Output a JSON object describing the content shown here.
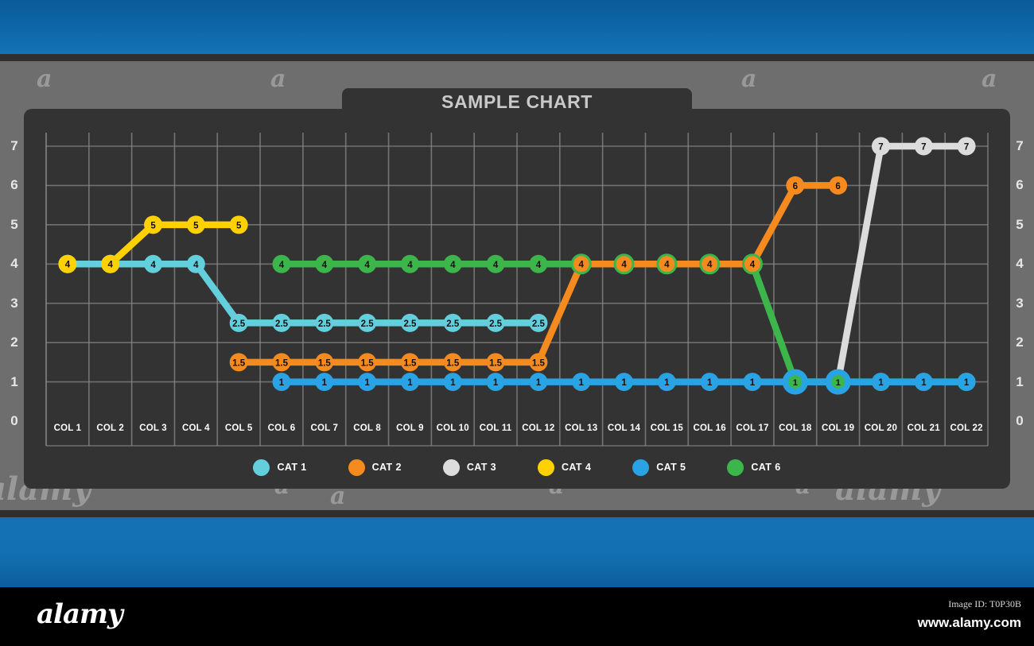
{
  "footer": {
    "logo": "alamy",
    "image_id": "Image ID: T0P30B",
    "url": "www.alamy.com"
  },
  "watermark": {
    "text": "a",
    "word": "alamy"
  },
  "chart": {
    "title": "SAMPLE CHART",
    "y_axis_labels_left": [
      "7",
      "6",
      "5",
      "4",
      "3",
      "2",
      "1",
      "0"
    ],
    "y_axis_labels_right": [
      "7",
      "6",
      "5",
      "4",
      "3",
      "2",
      "1",
      "0"
    ]
  },
  "chart_data": {
    "type": "line",
    "title": "SAMPLE CHART",
    "xlabel": "",
    "ylabel": "",
    "ylim": [
      0,
      7.6
    ],
    "grid": true,
    "legend_position": "bottom",
    "categories": [
      "COL 1",
      "COL 2",
      "COL 3",
      "COL 4",
      "COL 5",
      "COL 6",
      "COL 7",
      "COL 8",
      "COL 9",
      "COL 10",
      "COL 11",
      "COL 12",
      "COL 13",
      "COL 14",
      "COL 15",
      "COL 16",
      "COL 17",
      "COL 18",
      "COL 19",
      "COL 20",
      "COL 21",
      "COL 22"
    ],
    "yticks": [
      0,
      1,
      2,
      3,
      4,
      5,
      6,
      7
    ],
    "series": [
      {
        "name": "CAT 1",
        "color": "#63cfdd",
        "points": [
          {
            "x": "COL 1",
            "y": 4,
            "label": "4"
          },
          {
            "x": "COL 2",
            "y": 4,
            "label": "4"
          },
          {
            "x": "COL 3",
            "y": 4,
            "label": "4"
          },
          {
            "x": "COL 4",
            "y": 4,
            "label": "4"
          },
          {
            "x": "COL 5",
            "y": 2.5,
            "label": "2.5"
          },
          {
            "x": "COL 6",
            "y": 2.5,
            "label": "2.5"
          },
          {
            "x": "COL 7",
            "y": 2.5,
            "label": "2.5"
          },
          {
            "x": "COL 8",
            "y": 2.5,
            "label": "2.5"
          },
          {
            "x": "COL 9",
            "y": 2.5,
            "label": "2.5"
          },
          {
            "x": "COL 10",
            "y": 2.5,
            "label": "2.5"
          },
          {
            "x": "COL 11",
            "y": 2.5,
            "label": "2.5"
          },
          {
            "x": "COL 12",
            "y": 2.5,
            "label": "2.5"
          }
        ]
      },
      {
        "name": "CAT 2",
        "color": "#f58a1f",
        "points": [
          {
            "x": "COL 5",
            "y": 1.5,
            "label": "1.5"
          },
          {
            "x": "COL 6",
            "y": 1.5,
            "label": "1.5"
          },
          {
            "x": "COL 7",
            "y": 1.5,
            "label": "1.5"
          },
          {
            "x": "COL 8",
            "y": 1.5,
            "label": "1.5"
          },
          {
            "x": "COL 9",
            "y": 1.5,
            "label": "1.5"
          },
          {
            "x": "COL 10",
            "y": 1.5,
            "label": "1.5"
          },
          {
            "x": "COL 11",
            "y": 1.5,
            "label": "1.5"
          },
          {
            "x": "COL 12",
            "y": 1.5,
            "label": "1.5"
          },
          {
            "x": "COL 13",
            "y": 4,
            "label": "4"
          },
          {
            "x": "COL 14",
            "y": 4,
            "label": "4"
          },
          {
            "x": "COL 15",
            "y": 4,
            "label": "4"
          },
          {
            "x": "COL 16",
            "y": 4,
            "label": "4"
          },
          {
            "x": "COL 17",
            "y": 4,
            "label": "4"
          },
          {
            "x": "COL 18",
            "y": 6,
            "label": "6"
          },
          {
            "x": "COL 19",
            "y": 6,
            "label": "6"
          }
        ]
      },
      {
        "name": "CAT 3",
        "color": "#dcdcdc",
        "points": [
          {
            "x": "COL 18",
            "y": 1,
            "label": ""
          },
          {
            "x": "COL 19",
            "y": 1,
            "label": ""
          },
          {
            "x": "COL 20",
            "y": 7,
            "label": "7"
          },
          {
            "x": "COL 21",
            "y": 7,
            "label": "7"
          },
          {
            "x": "COL 22",
            "y": 7,
            "label": "7"
          }
        ]
      },
      {
        "name": "CAT 4",
        "color": "#ffd100",
        "points": [
          {
            "x": "COL 1",
            "y": 4,
            "label": "4"
          },
          {
            "x": "COL 2",
            "y": 4,
            "label": "4"
          },
          {
            "x": "COL 3",
            "y": 5,
            "label": "5"
          },
          {
            "x": "COL 4",
            "y": 5,
            "label": "5"
          },
          {
            "x": "COL 5",
            "y": 5,
            "label": "5"
          }
        ]
      },
      {
        "name": "CAT 5",
        "color": "#29a3e3",
        "points": [
          {
            "x": "COL 6",
            "y": 1,
            "label": "1"
          },
          {
            "x": "COL 7",
            "y": 1,
            "label": "1"
          },
          {
            "x": "COL 8",
            "y": 1,
            "label": "1"
          },
          {
            "x": "COL 9",
            "y": 1,
            "label": "1"
          },
          {
            "x": "COL 10",
            "y": 1,
            "label": "1"
          },
          {
            "x": "COL 11",
            "y": 1,
            "label": "1"
          },
          {
            "x": "COL 12",
            "y": 1,
            "label": "1"
          },
          {
            "x": "COL 13",
            "y": 1,
            "label": "1"
          },
          {
            "x": "COL 14",
            "y": 1,
            "label": "1"
          },
          {
            "x": "COL 15",
            "y": 1,
            "label": "1"
          },
          {
            "x": "COL 16",
            "y": 1,
            "label": "1"
          },
          {
            "x": "COL 17",
            "y": 1,
            "label": "1"
          },
          {
            "x": "COL 18",
            "y": 1,
            "label": "1"
          },
          {
            "x": "COL 19",
            "y": 1,
            "label": "1"
          },
          {
            "x": "COL 20",
            "y": 1,
            "label": "1"
          },
          {
            "x": "COL 21",
            "y": 1,
            "label": "1"
          },
          {
            "x": "COL 22",
            "y": 1,
            "label": "1"
          }
        ]
      },
      {
        "name": "CAT 6",
        "color": "#3cb54a",
        "points": [
          {
            "x": "COL 6",
            "y": 4,
            "label": "4"
          },
          {
            "x": "COL 7",
            "y": 4,
            "label": "4"
          },
          {
            "x": "COL 8",
            "y": 4,
            "label": "4"
          },
          {
            "x": "COL 9",
            "y": 4,
            "label": "4"
          },
          {
            "x": "COL 10",
            "y": 4,
            "label": "4"
          },
          {
            "x": "COL 11",
            "y": 4,
            "label": "4"
          },
          {
            "x": "COL 12",
            "y": 4,
            "label": "4"
          },
          {
            "x": "COL 13",
            "y": 4,
            "label": "4"
          },
          {
            "x": "COL 14",
            "y": 4,
            "label": "4"
          },
          {
            "x": "COL 15",
            "y": 4,
            "label": "4"
          },
          {
            "x": "COL 16",
            "y": 4,
            "label": "4"
          },
          {
            "x": "COL 17",
            "y": 4,
            "label": "4"
          },
          {
            "x": "COL 18",
            "y": 1,
            "label": "1"
          },
          {
            "x": "COL 19",
            "y": 1,
            "label": "1"
          },
          {
            "x": "COL 20",
            "y": 1,
            "label": "1"
          },
          {
            "x": "COL 21",
            "y": 1,
            "label": "1"
          },
          {
            "x": "COL 22",
            "y": 1,
            "label": "1"
          }
        ]
      }
    ],
    "legend": [
      {
        "name": "CAT 1",
        "color": "#63cfdd"
      },
      {
        "name": "CAT 2",
        "color": "#f58a1f"
      },
      {
        "name": "CAT 3",
        "color": "#dcdcdc"
      },
      {
        "name": "CAT 4",
        "color": "#ffd100"
      },
      {
        "name": "CAT 5",
        "color": "#29a3e3"
      },
      {
        "name": "CAT 6",
        "color": "#3cb54a"
      }
    ]
  }
}
